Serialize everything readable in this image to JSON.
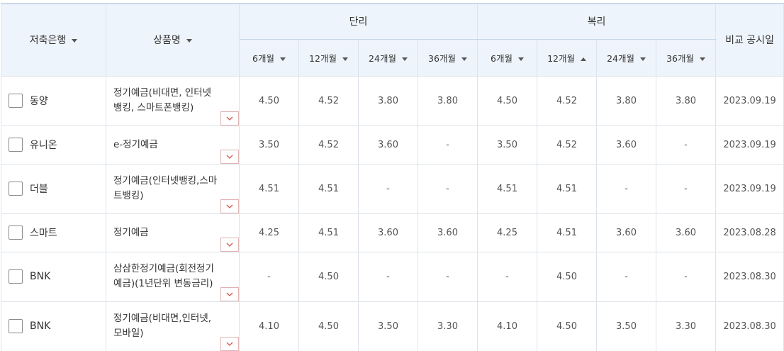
{
  "header": {
    "bank": "저축은행",
    "product": "상품명",
    "simple": "단리",
    "compound": "복리",
    "date": "비교 공시일",
    "simple_terms": [
      "6개월",
      "12개월",
      "24개월",
      "36개월"
    ],
    "compound_terms": [
      "6개월",
      "12개월",
      "24개월",
      "36개월"
    ]
  },
  "rows": [
    {
      "bank": "동양",
      "product": "정기예금(비대면, 인터넷뱅킹, 스마트폰뱅킹)",
      "simple": [
        "4.50",
        "4.52",
        "3.80",
        "3.80"
      ],
      "compound": [
        "4.50",
        "4.52",
        "3.80",
        "3.80"
      ],
      "date": "2023.09.19"
    },
    {
      "bank": "유니온",
      "product": "e-정기예금",
      "simple": [
        "3.50",
        "4.52",
        "3.60",
        "-"
      ],
      "compound": [
        "3.50",
        "4.52",
        "3.60",
        "-"
      ],
      "date": "2023.09.19"
    },
    {
      "bank": "더블",
      "product": "정기예금(인터넷뱅킹,스마트뱅킹)",
      "simple": [
        "4.51",
        "4.51",
        "-",
        "-"
      ],
      "compound": [
        "4.51",
        "4.51",
        "-",
        "-"
      ],
      "date": "2023.09.19"
    },
    {
      "bank": "스마트",
      "product": "정기예금",
      "simple": [
        "4.25",
        "4.51",
        "3.60",
        "3.60"
      ],
      "compound": [
        "4.25",
        "4.51",
        "3.60",
        "3.60"
      ],
      "date": "2023.08.28"
    },
    {
      "bank": "BNK",
      "product": "삼삼한정기예금(회전정기예금)(1년단위 변동금리)",
      "simple": [
        "-",
        "4.50",
        "-",
        "-"
      ],
      "compound": [
        "-",
        "4.50",
        "-",
        "-"
      ],
      "date": "2023.08.30"
    },
    {
      "bank": "BNK",
      "product": "정기예금(비대면,인터넷,모바일)",
      "simple": [
        "4.10",
        "4.50",
        "3.50",
        "3.30"
      ],
      "compound": [
        "4.10",
        "4.50",
        "3.50",
        "3.30"
      ],
      "date": "2023.08.30"
    }
  ],
  "icons": {
    "sort_default": "caret-down-icon",
    "sort_active": "caret-up-icon",
    "expand": "chevron-down-icon",
    "checkbox": "checkbox-icon"
  },
  "colors": {
    "header_bg": "#eef4fb",
    "border": "#dde3ea",
    "expand_chevron": "#d9534f"
  }
}
